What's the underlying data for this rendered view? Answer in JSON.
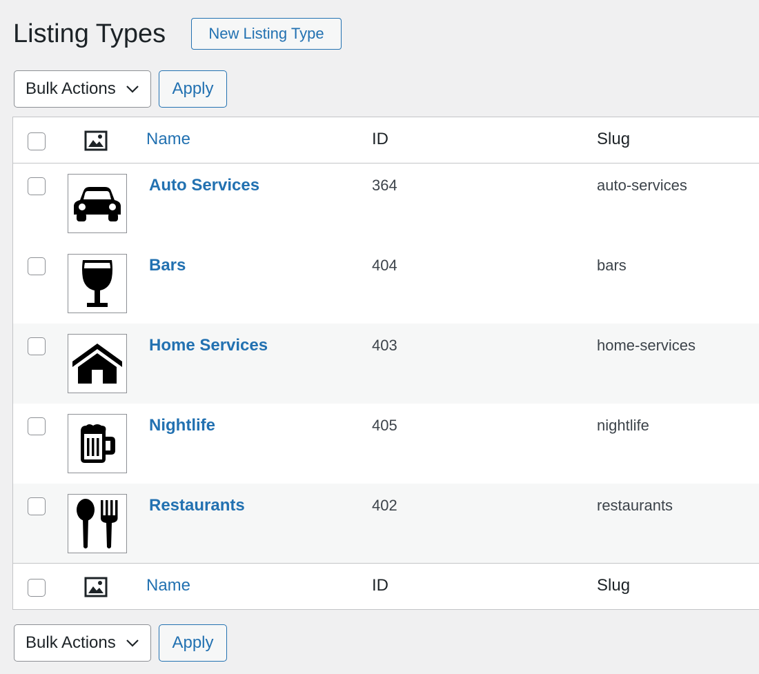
{
  "header": {
    "title": "Listing Types",
    "new_button": "New Listing Type"
  },
  "bulk_top": {
    "select_label": "Bulk Actions",
    "apply_label": "Apply"
  },
  "bulk_bottom": {
    "select_label": "Bulk Actions",
    "apply_label": "Apply"
  },
  "table": {
    "columns": {
      "name": "Name",
      "id": "ID",
      "slug": "Slug"
    },
    "rows": [
      {
        "name": "Auto Services",
        "id": "364",
        "slug": "auto-services",
        "icon": "car-icon"
      },
      {
        "name": "Bars",
        "id": "404",
        "slug": "bars",
        "icon": "wine-glass-icon"
      },
      {
        "name": "Home Services",
        "id": "403",
        "slug": "home-services",
        "icon": "house-icon"
      },
      {
        "name": "Nightlife",
        "id": "405",
        "slug": "nightlife",
        "icon": "beer-mug-icon"
      },
      {
        "name": "Restaurants",
        "id": "402",
        "slug": "restaurants",
        "icon": "utensils-icon"
      }
    ]
  },
  "colors": {
    "link": "#2271b1",
    "text": "#1d2327",
    "background": "#f0f0f1",
    "border": "#c3c4c7"
  }
}
